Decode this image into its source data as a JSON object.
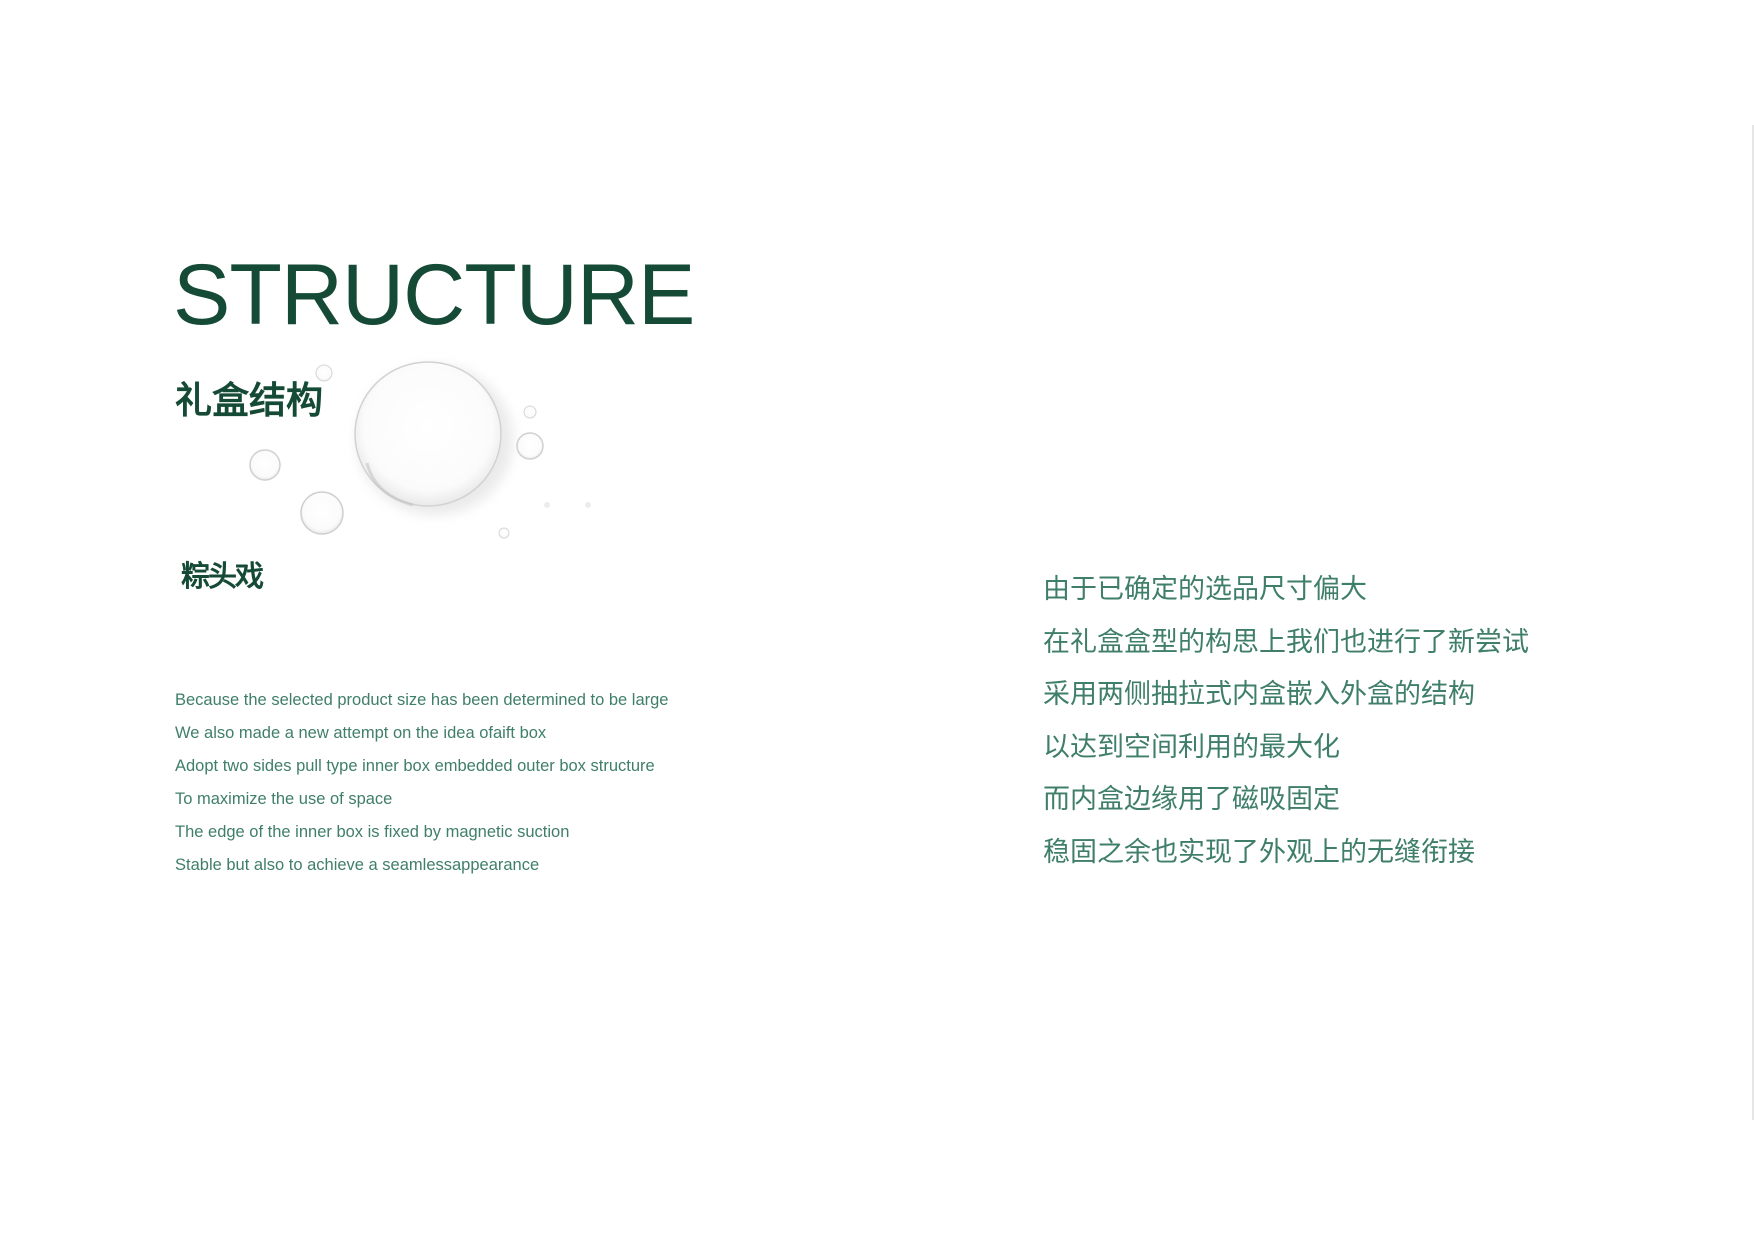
{
  "title": "STRUCTURE",
  "subtitle": "礼盒结构",
  "brand": "粽头戏",
  "english_lines": [
    "Because the selected product size has been determined to be large",
    "We also made a new attempt on the idea ofaift box",
    "Adopt two sides pull type inner box embedded outer box structure",
    "To maximize the use of space",
    "The edge of the inner box is fixed by magnetic suction",
    "Stable but also to achieve a seamlessappearance"
  ],
  "chinese_lines": [
    "由于已确定的选品尺寸偏大",
    "在礼盒盒型的构思上我们也进行了新尝试",
    "采用两侧抽拉式内盒嵌入外盒的结构",
    "以达到空间利用的最大化",
    "而内盒边缘用了磁吸固定",
    "稳固之余也实现了外观上的无缝衔接"
  ],
  "colors": {
    "heading": "#154a36",
    "body_text": "#3f7e6a",
    "background": "#ffffff"
  }
}
